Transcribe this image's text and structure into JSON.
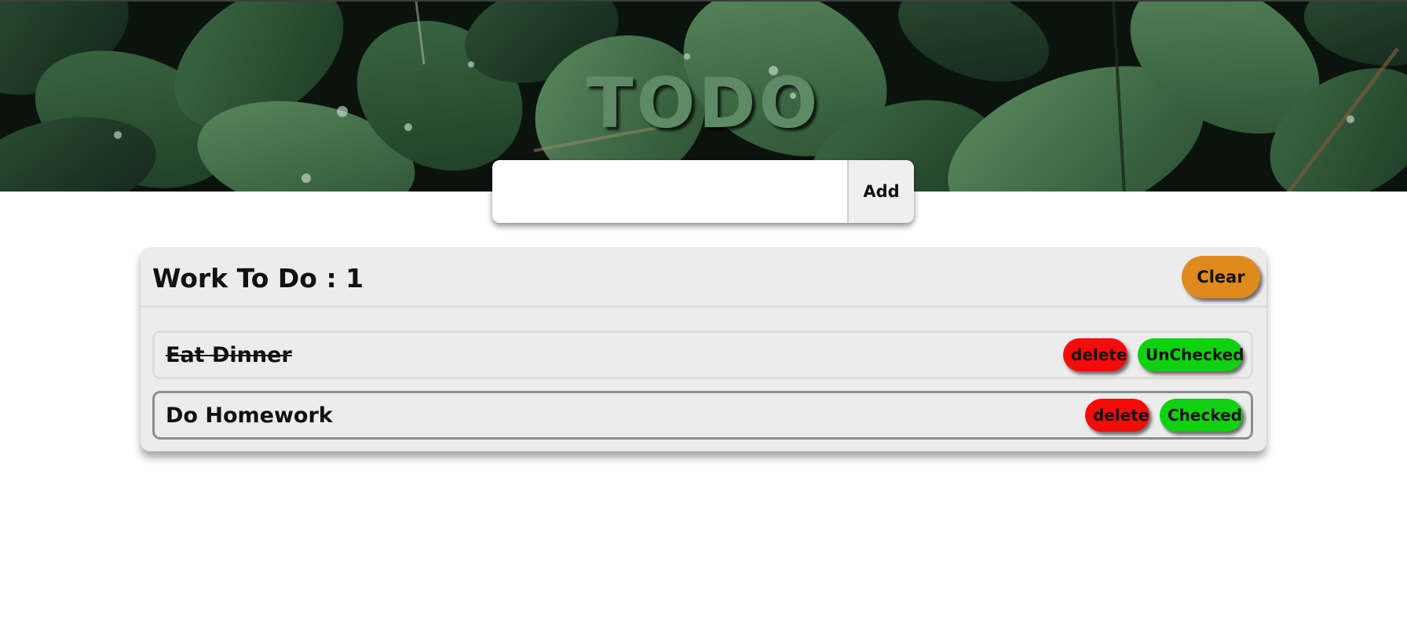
{
  "app": {
    "title": "TODO"
  },
  "add_form": {
    "input_value": "",
    "input_placeholder": "",
    "add_label": "Add"
  },
  "list": {
    "count_label": "Work To Do : 1",
    "clear_label": "Clear",
    "items": [
      {
        "text": "Eat Dinner",
        "completed": true,
        "delete_label": "delete",
        "toggle_label": "UnChecked"
      },
      {
        "text": "Do Homework",
        "completed": false,
        "delete_label": "delete",
        "toggle_label": "Checked"
      }
    ]
  },
  "colors": {
    "title": "#5f8a66",
    "clear_button": "#e08a1e",
    "delete_button": "#f70a0a",
    "toggle_button": "#0fd10f",
    "panel_background": "#ececec"
  }
}
